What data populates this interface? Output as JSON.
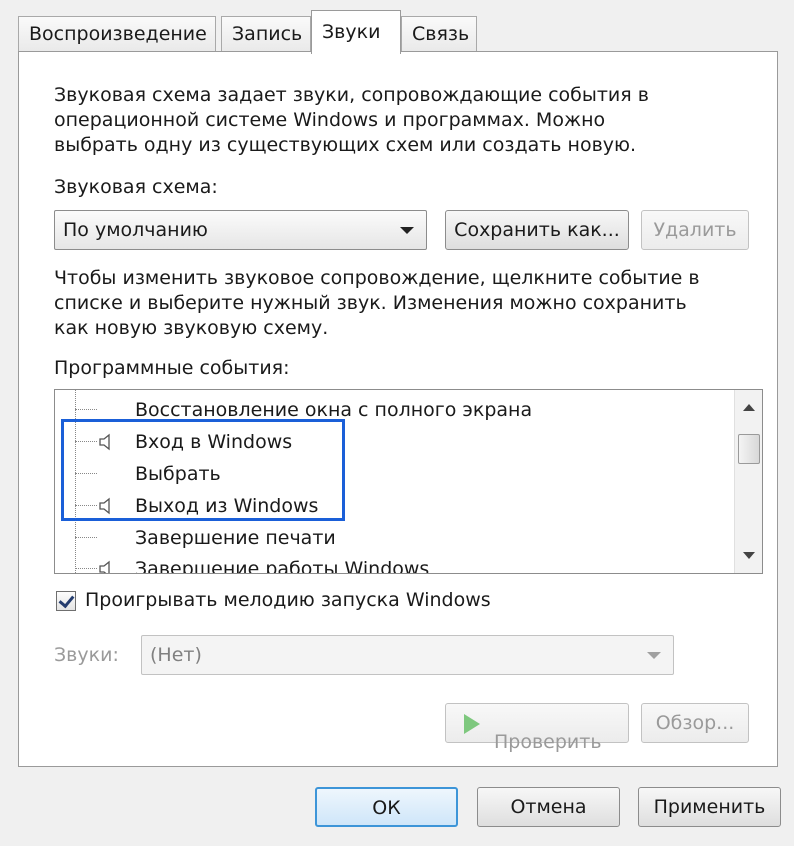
{
  "tabs": [
    {
      "label": "Воспроизведение"
    },
    {
      "label": "Запись"
    },
    {
      "label": "Звуки"
    },
    {
      "label": "Связь"
    }
  ],
  "active_tab": "Звуки",
  "description_lines": [
    "Звуковая схема задает звуки, сопровождающие события в",
    "операционной системе Windows и программах. Можно",
    "выбрать одну из существующих схем или создать новую."
  ],
  "scheme": {
    "label": "Звуковая схема:",
    "value": "По умолчанию",
    "save_as_label": "Сохранить как...",
    "delete_label": "Удалить"
  },
  "instruction_lines": [
    "Чтобы изменить звуковое сопровождение, щелкните событие в",
    "списке и выберите нужный звук. Изменения можно сохранить",
    "как новую звуковую схему."
  ],
  "events": {
    "label": "Программные события:",
    "items": [
      {
        "label": "Восстановление окна с полного экрана",
        "has_sound": false
      },
      {
        "label": "Вход в Windows",
        "has_sound": true
      },
      {
        "label": "Выбрать",
        "has_sound": false
      },
      {
        "label": "Выход из Windows",
        "has_sound": true
      },
      {
        "label": "Завершение печати",
        "has_sound": false
      },
      {
        "label": "Завершение работы Windows",
        "has_sound": true
      }
    ]
  },
  "startup_sound": {
    "label": "Проигрывать мелодию запуска Windows",
    "checked": true
  },
  "sounds": {
    "label": "Звуки:",
    "value": "(Нет)",
    "test_label": "Проверить",
    "browse_label": "Обзор..."
  },
  "footer": {
    "ok_label": "ОК",
    "cancel_label": "Отмена",
    "apply_label": "Применить"
  },
  "colors": {
    "highlight_border": "#1a5fd8",
    "play_icon": "#7ec87e",
    "default_button_border": "#3d95d8"
  }
}
